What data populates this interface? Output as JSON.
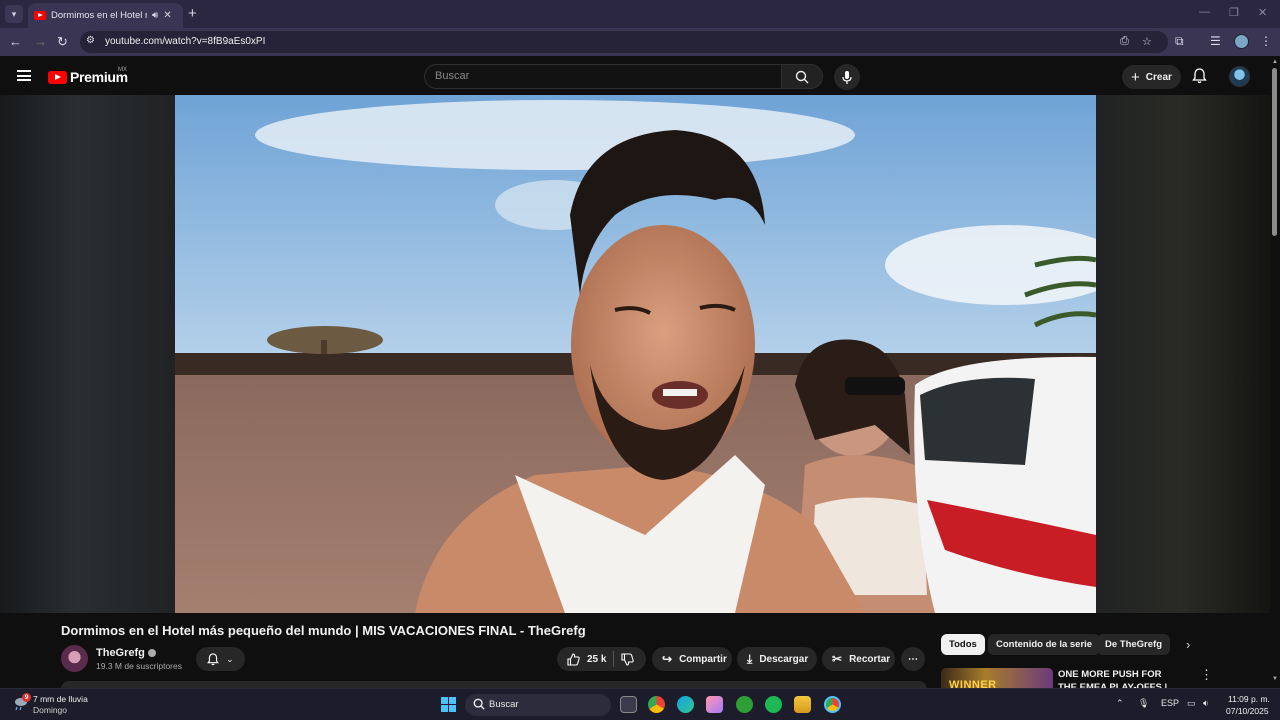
{
  "browser": {
    "tab_title": "Dormimos en el Hotel más pequeño del mundo",
    "url": "youtube.com/watch?v=8fB9aEs0xPI"
  },
  "youtube": {
    "logo_text": "Premium",
    "logo_region": "MX",
    "search_placeholder": "Buscar",
    "create_label": "Crear"
  },
  "video": {
    "title": "Dormimos en el Hotel más pequeño del mundo | MIS VACACIONES FINAL - TheGrefg",
    "channel_name": "TheGrefg",
    "subscribers": "19.3 M de suscriptores",
    "likes": "25 k",
    "share_label": "Compartir",
    "download_label": "Descargar",
    "clip_label": "Recortar"
  },
  "sidebar": {
    "chips": [
      "Todos",
      "Contenido de la serie",
      "De TheGrefg"
    ],
    "recommendation": {
      "title": "ONE MORE PUSH FOR THE EMEA PLAY-OFFS | LR vs GL",
      "thumb_text": "WINNER"
    }
  },
  "taskbar": {
    "weather_line1": "7 mm de lluvia",
    "weather_line2": "Domingo",
    "weather_badge": "9",
    "search_placeholder": "Buscar",
    "language": "ESP",
    "time": "11:09 p. m.",
    "date": "07/10/2025"
  }
}
